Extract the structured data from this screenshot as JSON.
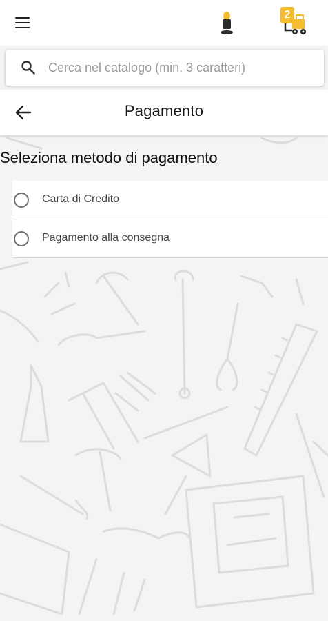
{
  "header": {
    "menu_icon": "hamburger-menu-icon",
    "logo_icon": "brand-logo-icon",
    "cart_icon": "forklift-cart-icon",
    "cart_count": "2",
    "accent_color": "#f3bd2f"
  },
  "search": {
    "icon": "search-icon",
    "placeholder": "Cerca nel catalogo (min. 3 caratteri)",
    "value": ""
  },
  "page": {
    "back_icon": "arrow-left-icon",
    "title": "Pagamento"
  },
  "payment": {
    "heading": "Seleziona metodo di pagamento",
    "options": [
      {
        "label": "Carta di Credito",
        "selected": false
      },
      {
        "label": "Pagamento alla consegna",
        "selected": false
      }
    ]
  }
}
